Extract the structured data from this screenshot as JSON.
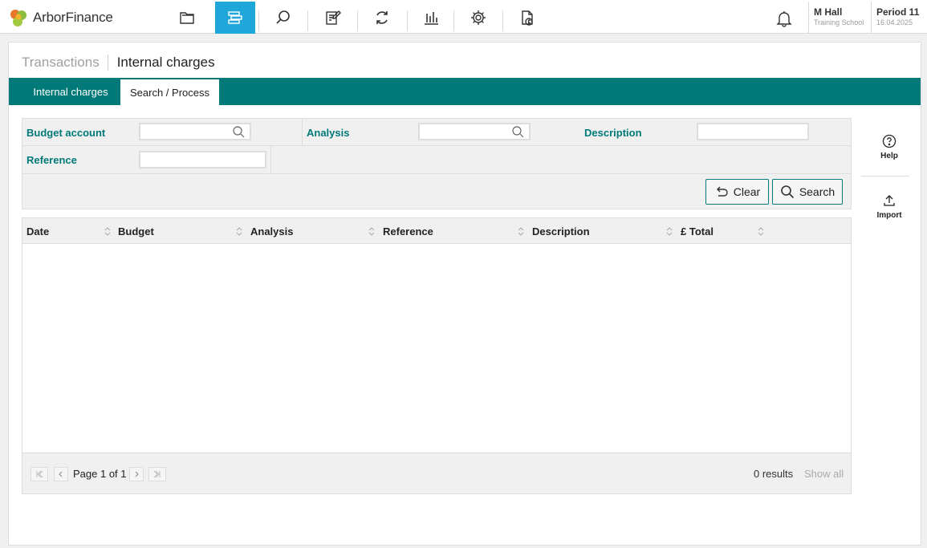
{
  "app": {
    "name": "ArborFinance"
  },
  "nav": {
    "items": [
      {
        "icon": "folder-icon"
      },
      {
        "icon": "ledger-icon",
        "active": true
      },
      {
        "icon": "search-icon"
      },
      {
        "icon": "edit-document-icon"
      },
      {
        "icon": "refresh-cycle-icon"
      },
      {
        "icon": "bar-chart-icon"
      },
      {
        "icon": "gear-icon"
      },
      {
        "icon": "invoice-pound-icon"
      }
    ]
  },
  "user": {
    "name": "M Hall",
    "school": "Training School"
  },
  "period": {
    "label": "Period 11",
    "date": "16.04.2025"
  },
  "breadcrumb": {
    "parent": "Transactions",
    "current": "Internal charges"
  },
  "tabs": {
    "internal": "Internal charges",
    "search": "Search / Process"
  },
  "filters": {
    "budget_account": {
      "label": "Budget account",
      "value": ""
    },
    "analysis": {
      "label": "Analysis",
      "value": ""
    },
    "description": {
      "label": "Description",
      "value": ""
    },
    "reference": {
      "label": "Reference",
      "value": ""
    }
  },
  "buttons": {
    "clear": "Clear",
    "search": "Search"
  },
  "table": {
    "columns": [
      "Date",
      "Budget",
      "Analysis",
      "Reference",
      "Description",
      "£ Total"
    ],
    "rows": []
  },
  "pagination": {
    "page_text": "Page 1 of 1",
    "results": "0 results",
    "show_all": "Show all"
  },
  "side_actions": {
    "help": "Help",
    "import": "Import"
  },
  "colors": {
    "accent": "#007a78",
    "nav_active": "#1ea7d8"
  }
}
